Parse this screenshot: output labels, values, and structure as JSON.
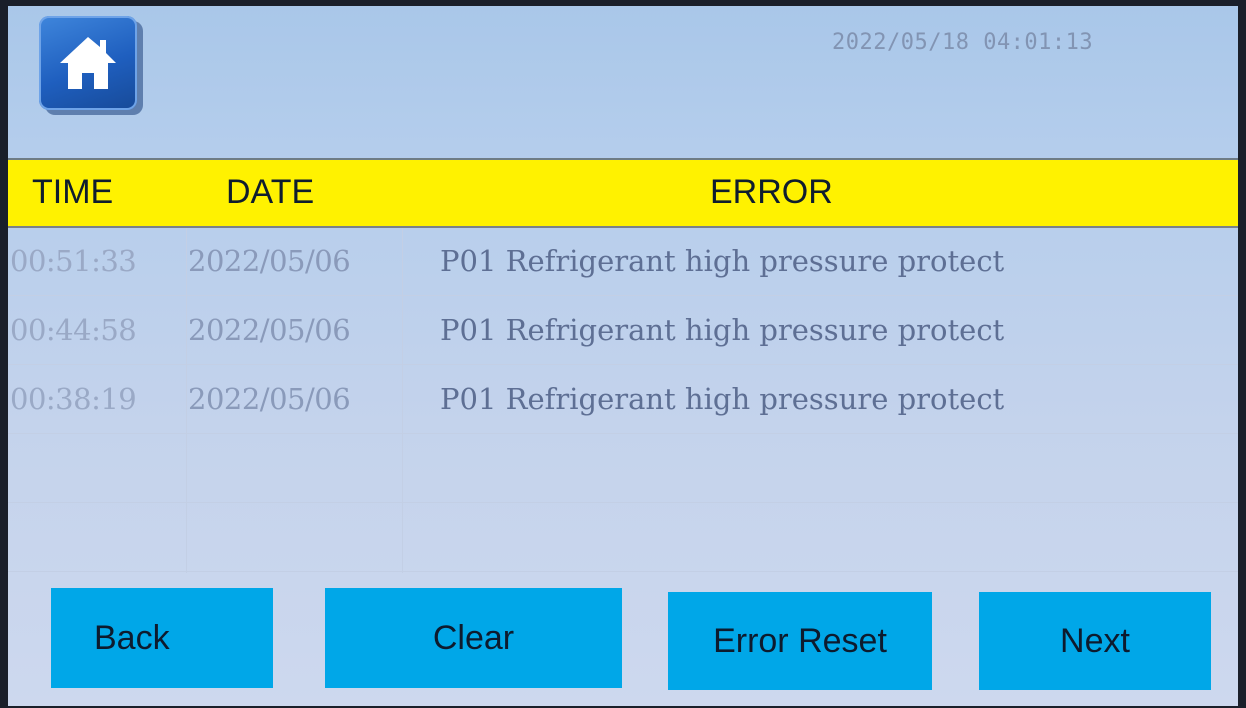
{
  "status": {
    "datetime": "2022/05/18 04:01:13"
  },
  "table": {
    "headers": {
      "time": "TIME",
      "date": "DATE",
      "error": "ERROR"
    },
    "rows": [
      {
        "time": "00:51:33",
        "date": "2022/05/06",
        "error": "P01 Refrigerant high pressure protect"
      },
      {
        "time": "00:44:58",
        "date": "2022/05/06",
        "error": "P01 Refrigerant high pressure protect"
      },
      {
        "time": "00:38:19",
        "date": "2022/05/06",
        "error": "P01 Refrigerant high pressure protect"
      },
      {
        "time": "",
        "date": "",
        "error": ""
      },
      {
        "time": "",
        "date": "",
        "error": ""
      }
    ]
  },
  "buttons": {
    "back": "Back",
    "clear": "Clear",
    "error_reset": "Error Reset",
    "next": "Next"
  },
  "icons": {
    "home": "home-icon"
  },
  "colors": {
    "header_bar": "#fff200",
    "button": "#00a7e8",
    "home_button": "#1f5fbf"
  }
}
